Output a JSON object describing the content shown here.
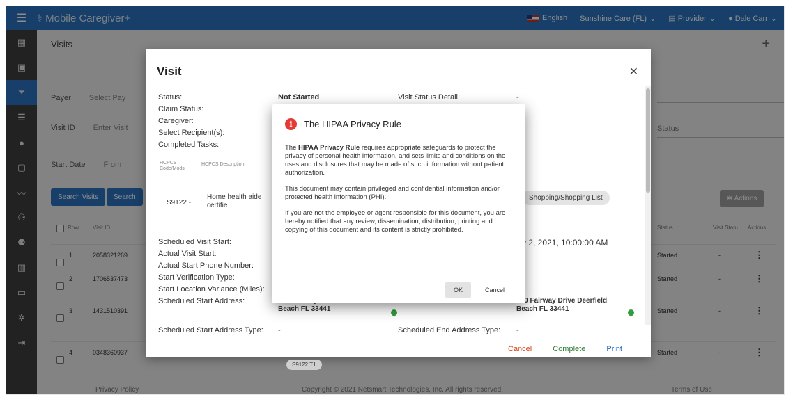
{
  "topbar": {
    "app_name": "Mobile Caregiver+",
    "language": "English",
    "agency": "Sunshine Care (FL)",
    "role": "Provider",
    "user": "Dale Carr"
  },
  "page": {
    "title": "Visits",
    "payer_label": "Payer",
    "payer_placeholder": "Select Pay",
    "visit_id_label": "Visit ID",
    "visit_id_placeholder": "Enter Visit",
    "start_date_label": "Start Date",
    "start_date_placeholder": "From",
    "status_placeholder": "Status",
    "search_visits": "Search Visits",
    "search_second": "Search",
    "actions": "Actions",
    "table_headers": [
      "Row",
      "Visit ID",
      "Status",
      "Visit Statu",
      "Actions"
    ],
    "rows": [
      {
        "row": "1",
        "visit_id": "2058321269",
        "status": "Started",
        "visit_status": "-"
      },
      {
        "row": "2",
        "visit_id": "1706537473",
        "status": "Started",
        "visit_status": "-"
      },
      {
        "row": "3",
        "visit_id": "1431510391",
        "status": "Started",
        "visit_status": "-"
      },
      {
        "row": "4",
        "visit_id": "0348360937",
        "status": "Started",
        "visit_status": "-"
      }
    ],
    "footer_left": "Privacy Policy",
    "footer_center": "Copyright © 2021 Netsmart Technologies, Inc. All rights reserved.",
    "footer_right": "Terms of Use"
  },
  "visit": {
    "title": "Visit",
    "status_label": "Status:",
    "status_value": "Not Started",
    "visit_status_detail_label": "Visit Status Detail:",
    "visit_status_detail_value": "-",
    "claim_status_label": "Claim Status:",
    "caregiver_label": "Caregiver:",
    "recipients_label": "Select Recipient(s):",
    "tasks_label": "Completed Tasks:",
    "hcpcs_code_header": "HCPCS Code/Mods",
    "hcpcs_desc_header": "HCPCS Description",
    "hcpcs_code": "S9122 -",
    "hcpcs_desc": "Home health aide certifie",
    "task_chip": "Shopping/Shopping List",
    "scheduled_visit_start_label": "Scheduled Visit Start:",
    "scheduled_visit_start_value": "v 2, 2021, 10:00:00 AM",
    "actual_visit_start_label": "Actual Visit Start:",
    "actual_phone_label": "Actual Start Phone Number:",
    "verification_label": "Start Verification Type:",
    "variance_label": "Start Location Variance (Miles):",
    "sched_start_address_label": "Scheduled Start Address:",
    "sched_start_address_value": "800 Fairway Drive Deerfield Beach FL 33441",
    "sched_end_address_label": "Scheduled End Address:",
    "sched_end_address_value": "800 Fairway Drive Deerfield Beach FL 33441",
    "sched_start_type_label": "Scheduled Start Address Type:",
    "sched_start_type_value": "-",
    "sched_end_type_label": "Scheduled End Address Type:",
    "sched_end_type_value": "-",
    "partial_chip": "S9122 T1",
    "cancel": "Cancel",
    "complete": "Complete",
    "print": "Print"
  },
  "hipaa": {
    "title": "The HIPAA Privacy Rule",
    "p1_bold": "HIPAA Privacy Rule",
    "p1_pre": "The ",
    "p1_rest": " requires appropriate safeguards to protect the privacy of personal health information, and sets limits and conditions on the uses and disclosures that may be made of such information without patient authorization.",
    "p2": "This document may contain privileged and confidential information and/or protected health information (PHI).",
    "p3": "If you are not the employee or agent responsible for this document, you are hereby notified that any review, dissemination, distribution, printing and copying of this document and its content is strictly prohibited.",
    "ok": "OK",
    "cancel": "Cancel"
  },
  "colors": {
    "brand_blue": "#2a74bf",
    "sidebar_dark": "#3f3f3f",
    "danger_red": "#e53935",
    "success_green": "#2e7d32"
  }
}
